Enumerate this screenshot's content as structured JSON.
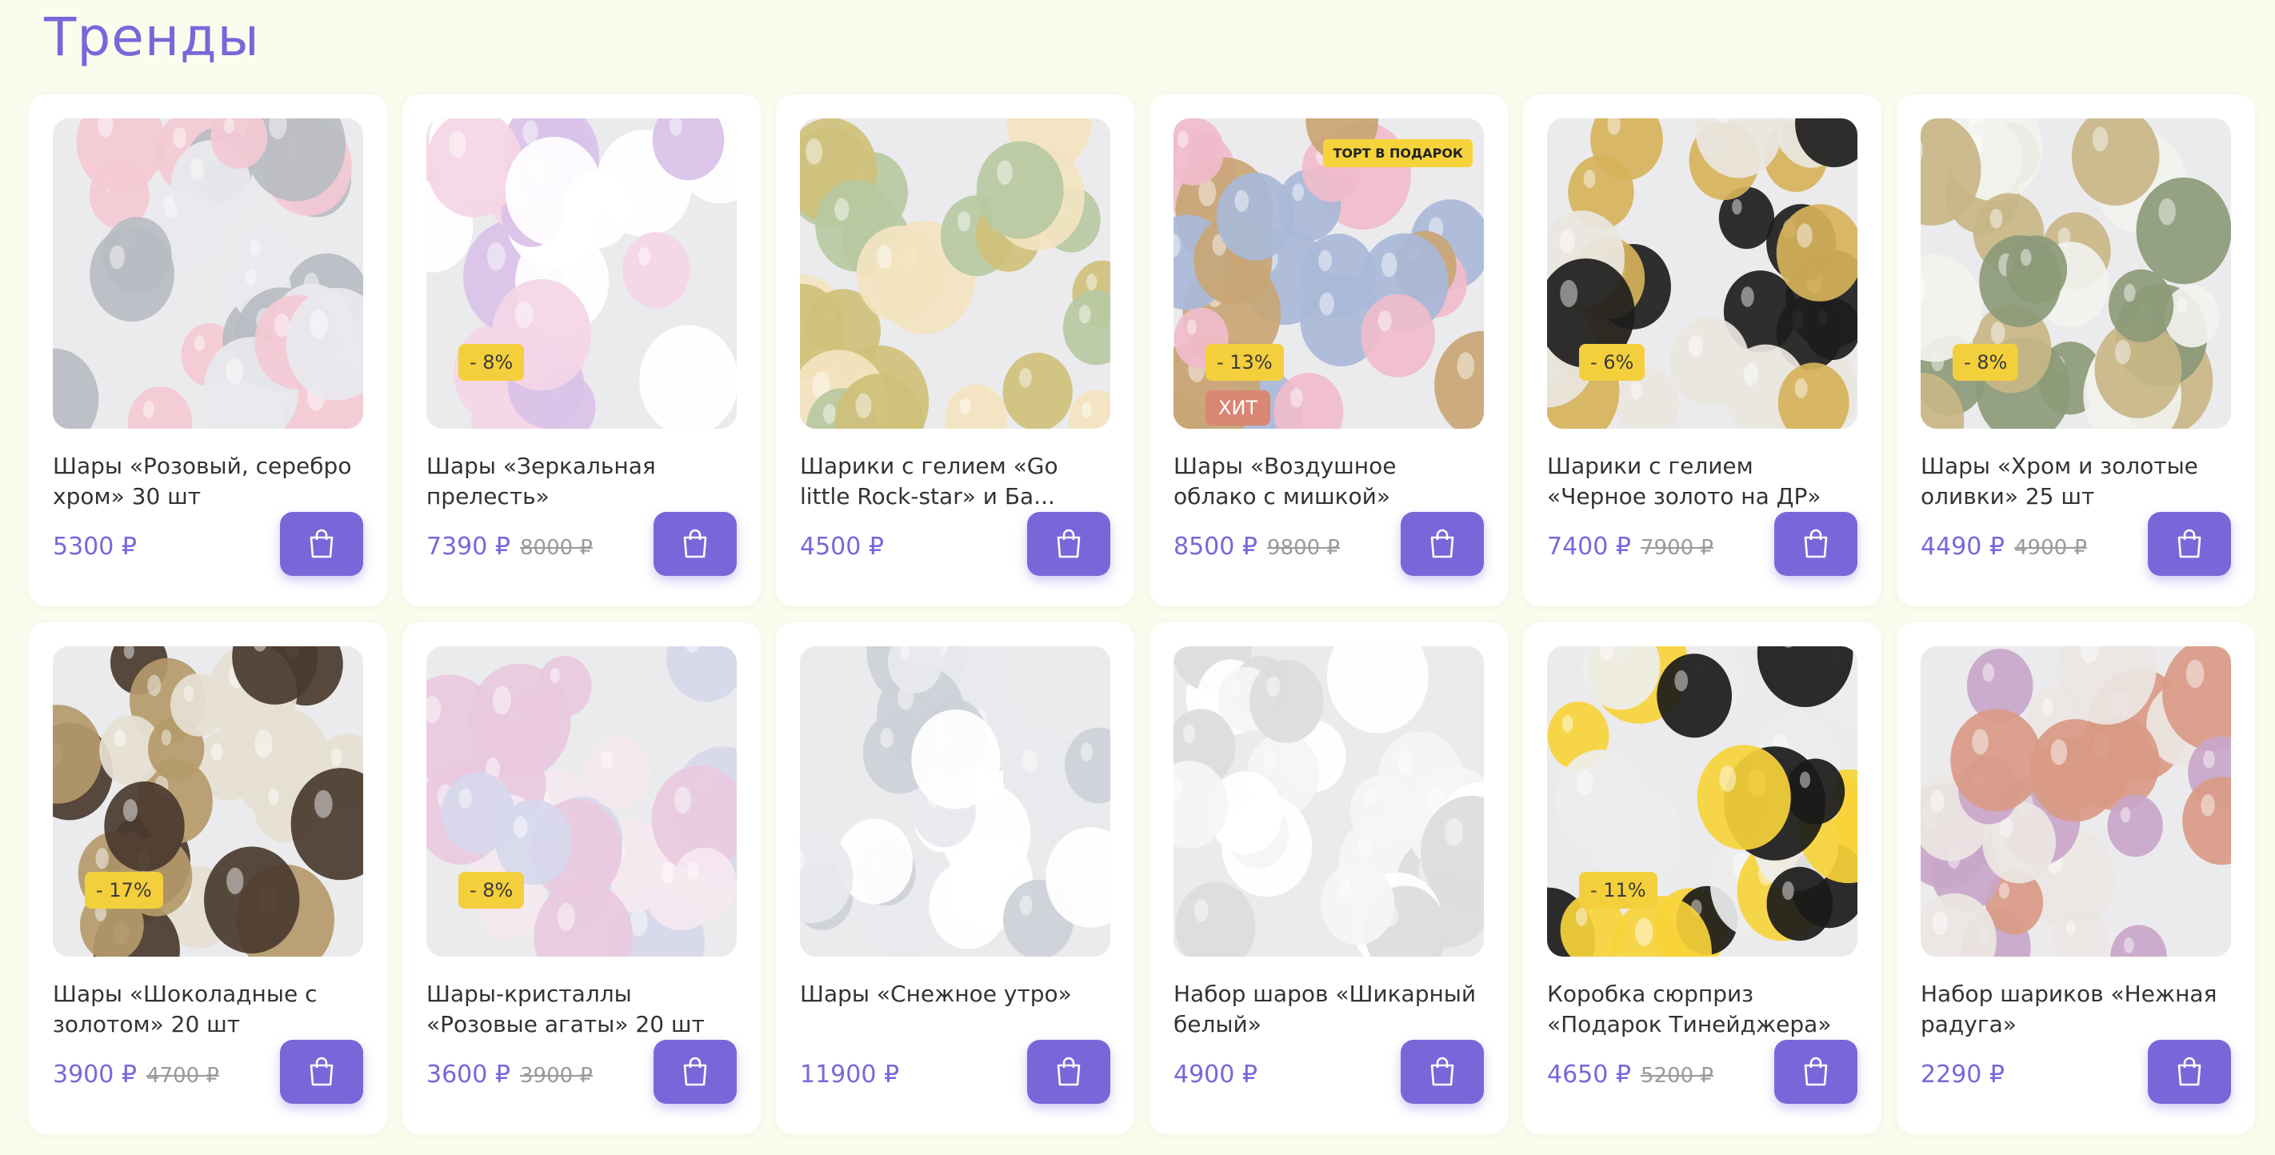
{
  "section": {
    "title": "Тренды"
  },
  "colors": {
    "accent": "#7b66d9",
    "discount_badge": "#f4cf3c",
    "hit_badge": "#d98675",
    "page_bg": "#fbfbee"
  },
  "icons": {
    "cart": "shopping-bag-icon"
  },
  "products": [
    {
      "name": "Шары «Розовый, серебро хром» 30 шт",
      "price": "5300 ₽",
      "old_price": "",
      "discount": "",
      "hit": "",
      "promo": "",
      "palette": [
        "#f3c9d4",
        "#b9bcc2",
        "#e9e9ee"
      ]
    },
    {
      "name": "Шары «Зеркальная прелесть»",
      "price": "7390 ₽",
      "old_price": "8000 ₽",
      "discount": "- 8%",
      "hit": "",
      "promo": "",
      "palette": [
        "#f4d6e6",
        "#ffffff",
        "#d9c2e8"
      ]
    },
    {
      "name": "Шарики с гелием «Go little Rock-star» и Ба...",
      "price": "4500 ₽",
      "old_price": "",
      "discount": "",
      "hit": "",
      "promo": "",
      "palette": [
        "#b7c9a2",
        "#f3e4c0",
        "#cfc07a"
      ]
    },
    {
      "name": "Шары «Воздушное облако с мишкой»",
      "price": "8500 ₽",
      "old_price": "9800 ₽",
      "discount": "- 13%",
      "hit": "ХИТ",
      "promo": "ТОРТ В ПОДАРОК",
      "palette": [
        "#a9b8d8",
        "#f0bccb",
        "#c9a574"
      ]
    },
    {
      "name": "Шарики с гелием «Черное золото на ДР»",
      "price": "7400 ₽",
      "old_price": "7900 ₽",
      "discount": "- 6%",
      "hit": "",
      "promo": "",
      "palette": [
        "#1d1d1d",
        "#d6b25a",
        "#e9e6df"
      ]
    },
    {
      "name": "Шары «Хром и золотые оливки» 25 шт",
      "price": "4490 ₽",
      "old_price": "4900 ₽",
      "discount": "- 8%",
      "hit": "",
      "promo": "",
      "palette": [
        "#8c9a78",
        "#c8b686",
        "#f2f2ee"
      ]
    },
    {
      "name": "Шары «Шоколадные с золотом» 20 шт",
      "price": "3900 ₽",
      "old_price": "4700 ₽",
      "discount": "- 17%",
      "hit": "",
      "promo": "",
      "palette": [
        "#4a3a2e",
        "#b49a6a",
        "#e6dfd2"
      ]
    },
    {
      "name": "Шары-кристаллы «Розовые агаты» 20 шт",
      "price": "3600 ₽",
      "old_price": "3900 ₽",
      "discount": "- 8%",
      "hit": "",
      "promo": "",
      "palette": [
        "#e9c9e0",
        "#d6d8ec",
        "#f5e8f0"
      ]
    },
    {
      "name": "Шары «Снежное утро»",
      "price": "11900 ₽",
      "old_price": "",
      "discount": "",
      "hit": "",
      "promo": "",
      "palette": [
        "#e8e9ee",
        "#ffffff",
        "#cdd0d8"
      ]
    },
    {
      "name": "Набор шаров «Шикарный белый»",
      "price": "4900 ₽",
      "old_price": "",
      "discount": "",
      "hit": "",
      "promo": "",
      "palette": [
        "#f5f5f5",
        "#ffffff",
        "#dcdcdc"
      ]
    },
    {
      "name": "Коробка сюрприз «Подарок Тинейджера»",
      "price": "4650 ₽",
      "old_price": "5200 ₽",
      "discount": "- 11%",
      "hit": "",
      "promo": "",
      "palette": [
        "#f7d23a",
        "#1a1a1a",
        "#ededed"
      ]
    },
    {
      "name": "Набор шариков «Нежная радуга»",
      "price": "2290 ₽",
      "old_price": "",
      "discount": "",
      "hit": "",
      "promo": "",
      "palette": [
        "#c9a6c9",
        "#d99a86",
        "#ece6e3"
      ]
    }
  ]
}
